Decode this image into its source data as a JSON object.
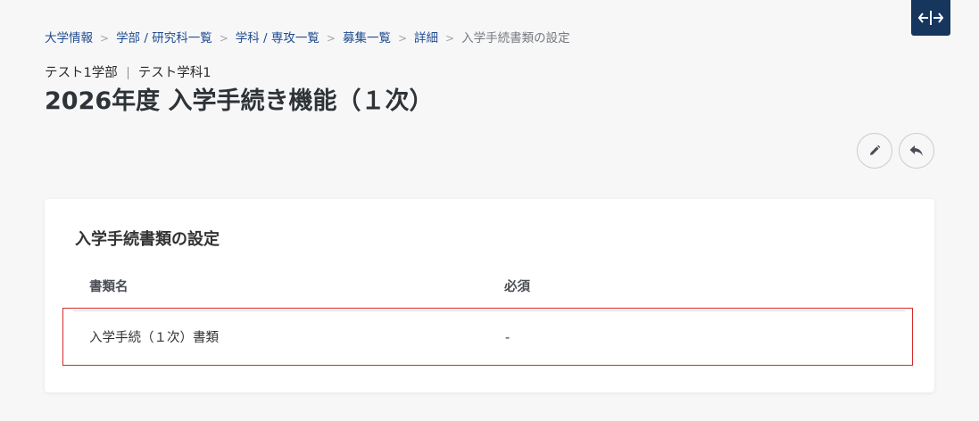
{
  "breadcrumb": {
    "items": [
      "大学情報",
      "学部 / 研究科一覧",
      "学科 / 専攻一覧",
      "募集一覧",
      "詳細"
    ],
    "current": "入学手続書類の設定",
    "separator": ">"
  },
  "header": {
    "faculty": "テスト1学部",
    "department": "テスト学科1",
    "title": "2026年度 入学手続き機能（１次）"
  },
  "actions": {
    "expand_icon": "expand-horizontal-icon",
    "edit_icon": "pencil-icon",
    "back_icon": "reply-arrow-icon"
  },
  "card": {
    "title": "入学手続書類の設定",
    "columns": {
      "name": "書類名",
      "required": "必須"
    },
    "rows": [
      {
        "name": "入学手続（１次）書類",
        "required": "-"
      }
    ]
  },
  "colors": {
    "accent": "#16365e",
    "link": "#1f4b8f",
    "highlight_border": "#d42a2a",
    "background": "#f7f7f8"
  }
}
